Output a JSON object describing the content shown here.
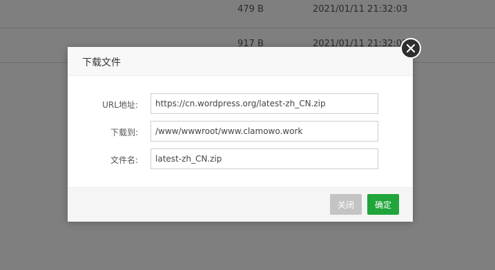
{
  "background_list": {
    "rows": [
      {
        "size": "479 B",
        "time": "2021/01/11 21:32:03"
      },
      {
        "size": "917 B",
        "time": "2021/01/11 21:32:03"
      }
    ]
  },
  "dialog": {
    "title": "下载文件",
    "fields": {
      "url": {
        "label": "URL地址:",
        "value": "https://cn.wordpress.org/latest-zh_CN.zip"
      },
      "path": {
        "label": "下载到:",
        "value": "/www/wwwroot/www.clamowo.work"
      },
      "filename": {
        "label": "文件名:",
        "value": "latest-zh_CN.zip"
      }
    },
    "buttons": {
      "cancel": "关闭",
      "ok": "确定"
    },
    "close_icon": "close-icon"
  },
  "colors": {
    "primary": "#20a53a",
    "cancel": "#c4c4c4"
  }
}
